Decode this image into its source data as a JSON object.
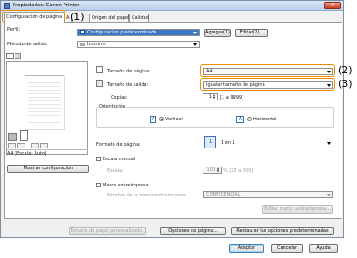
{
  "window": {
    "title": "Propiedades: Canon Printer",
    "close_label": "✕"
  },
  "tabs": [
    {
      "label": "Configuración de página",
      "active": true
    },
    {
      "label": "A"
    },
    {
      "label": "Origen del papel"
    },
    {
      "label": "Calidad"
    }
  ],
  "callouts": {
    "c1": "(1)",
    "c2": "(2)",
    "c3": "(3)"
  },
  "profile": {
    "label": "Perfil:",
    "value": "Configuración predeterminada",
    "add_button": "Agregar(1)...",
    "edit_button": "Editar(2)..."
  },
  "output_method": {
    "label": "Método de salida:",
    "value": "Imprimir"
  },
  "page_size": {
    "label": "Tamaño de página:",
    "value": "A4"
  },
  "output_size": {
    "label": "Tamaño de salida:",
    "value": "Igualar tamaño de página"
  },
  "copies": {
    "label": "Copias:",
    "value": "1",
    "range": "[1 a 9999]"
  },
  "orientation": {
    "label": "Orientación",
    "portrait": "Vertical",
    "landscape": "Horizontal",
    "portrait_icon": "A",
    "landscape_icon": "A"
  },
  "page_layout": {
    "label": "Formato de página:",
    "value": "1 en 1",
    "icon_text": "1"
  },
  "manual_scaling": {
    "label": "Escala manual",
    "scale_label": "Escala:",
    "scale_value": "100",
    "scale_range": "% [25 a 200]"
  },
  "watermark": {
    "label": "Marca sobreimpresa",
    "name_label": "Nombre de la marca sobreimpresa:",
    "name_value": "CONFIDENCIAL",
    "edit_button": "Editar marca sobreimpresa..."
  },
  "preview": {
    "caption": "A4 [Escala: Auto]",
    "show_settings_button": "Mostrar configuración"
  },
  "bottom_buttons": {
    "custom_size": "Tamaño de papel personalizado...",
    "page_options": "Opciones de página...",
    "restore": "Restaurar las opciones predeterminadas"
  },
  "dialog_buttons": {
    "ok": "Aceptar",
    "cancel": "Cancelar",
    "help": "Ayuda"
  },
  "colors": {
    "accent": "#f08a00",
    "selection": "#3d77c5"
  }
}
